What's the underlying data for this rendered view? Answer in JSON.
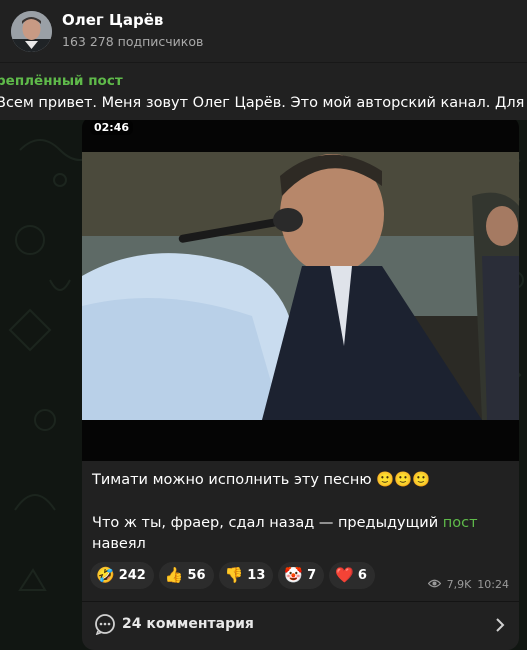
{
  "channel": {
    "title": "Олег Царёв",
    "subscribers": "163 278 подписчиков"
  },
  "pinned": {
    "title": "реплённый пост",
    "text": "Всем привет. Меня зовут Олег Царёв. Это мой авторский канал. Для знак"
  },
  "post": {
    "video_time": "02:46",
    "caption": "Тимати можно исполнить эту песню 🙂🙂🙂",
    "line2_before": "Что ж ты, фраер, сдал назад — предыдущий ",
    "line2_link": "пост",
    "line2_after": "навеял",
    "reactions": [
      {
        "emoji": "🤣",
        "count": "242"
      },
      {
        "emoji": "👍",
        "count": "56"
      },
      {
        "emoji": "👎",
        "count": "13"
      },
      {
        "emoji": "🤡",
        "count": "7"
      },
      {
        "emoji": "❤️",
        "count": "6"
      }
    ],
    "views": "7,9K",
    "time": "10:24",
    "comments_label": "24 комментария"
  },
  "colors": {
    "accent_green": "#5fba4a",
    "header_bg": "#212121",
    "bubble_bg": "#212121"
  },
  "icons": {
    "views": "eye-icon",
    "comments": "comment-bubble-icon",
    "chevron": "chevron-right-icon"
  }
}
